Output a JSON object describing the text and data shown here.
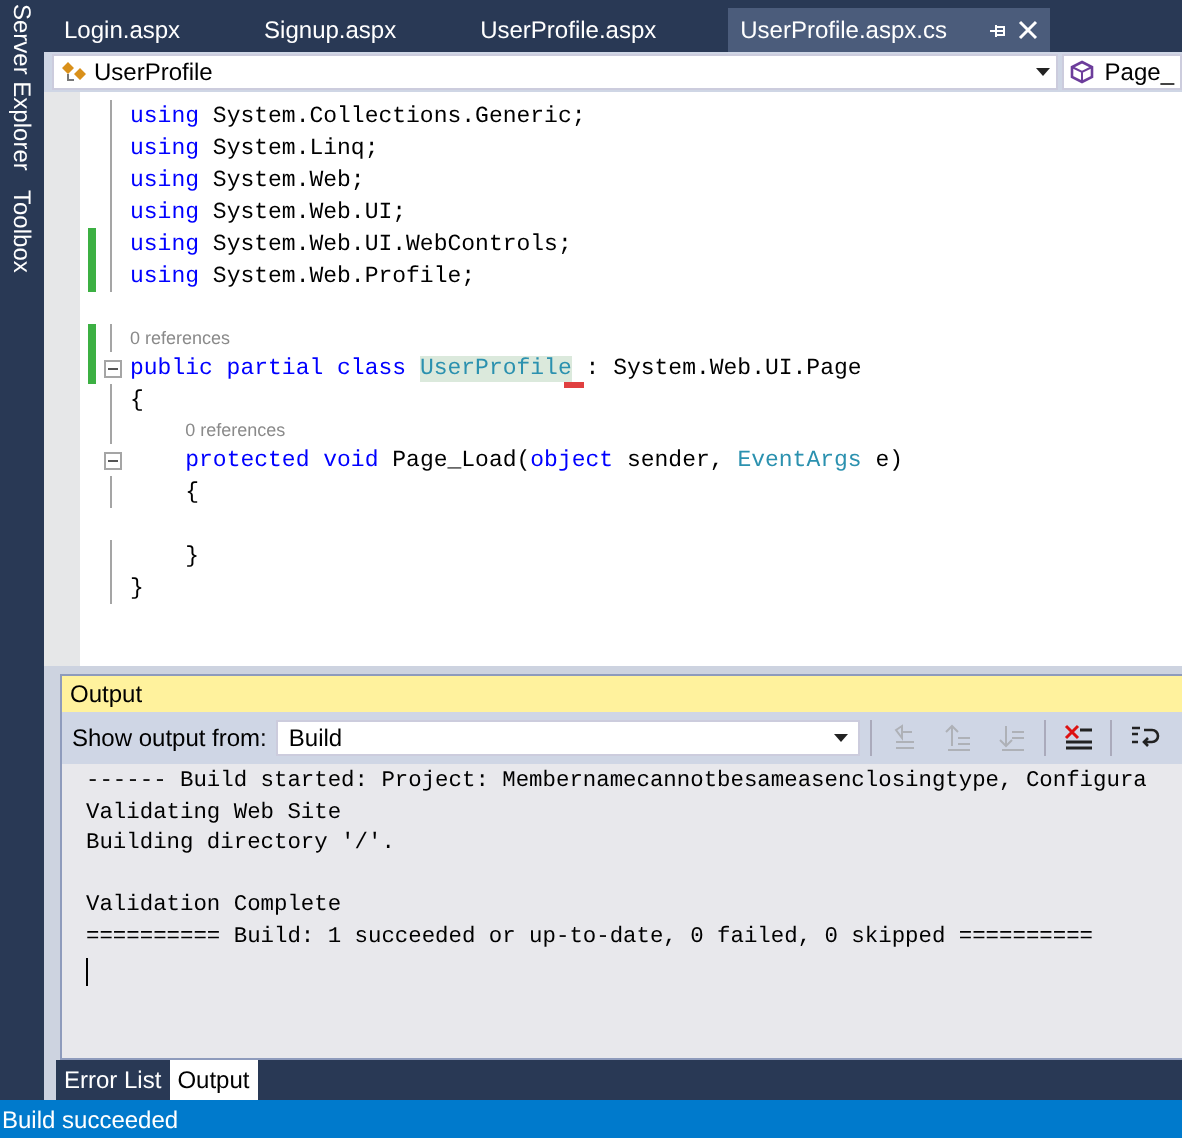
{
  "sidebar": {
    "tabs": [
      {
        "label": "Server Explorer"
      },
      {
        "label": "Toolbox"
      }
    ]
  },
  "document_tabs": [
    {
      "label": "Login.aspx",
      "selected": false
    },
    {
      "label": "Signup.aspx",
      "selected": false
    },
    {
      "label": "UserProfile.aspx",
      "selected": false
    },
    {
      "label": "UserProfile.aspx.cs",
      "selected": true
    }
  ],
  "navigation_bar": {
    "class_dropdown": "UserProfile",
    "member_dropdown": "Page_"
  },
  "code_lines": [
    {
      "kind": "code",
      "changed": false,
      "foldable": false,
      "segments": [
        {
          "text": "using",
          "kind": "keyword"
        },
        {
          "text": " System.Collections.Generic;",
          "kind": "plain"
        }
      ]
    },
    {
      "kind": "code",
      "changed": false,
      "foldable": false,
      "segments": [
        {
          "text": "using",
          "kind": "keyword"
        },
        {
          "text": " System.Linq;",
          "kind": "plain"
        }
      ]
    },
    {
      "kind": "code",
      "changed": false,
      "foldable": false,
      "segments": [
        {
          "text": "using",
          "kind": "keyword"
        },
        {
          "text": " System.Web;",
          "kind": "plain"
        }
      ]
    },
    {
      "kind": "code",
      "changed": false,
      "foldable": false,
      "segments": [
        {
          "text": "using",
          "kind": "keyword"
        },
        {
          "text": " System.Web.UI;",
          "kind": "plain"
        }
      ]
    },
    {
      "kind": "code",
      "changed": true,
      "foldable": false,
      "segments": [
        {
          "text": "using",
          "kind": "keyword"
        },
        {
          "text": " System.Web.UI.WebControls;",
          "kind": "plain"
        }
      ]
    },
    {
      "kind": "code",
      "changed": true,
      "foldable": false,
      "segments": [
        {
          "text": "using",
          "kind": "keyword"
        },
        {
          "text": " System.Web.Profile;",
          "kind": "plain"
        }
      ]
    },
    {
      "kind": "blank"
    },
    {
      "kind": "code",
      "changed": true,
      "foldable": true,
      "lens": "0 references",
      "segments": [
        {
          "text": "public partial class",
          "kind": "keyword"
        },
        {
          "text": "UserProfile",
          "kind": "highlight"
        },
        {
          "text": " : System.Web.UI.Page",
          "kind": "plain"
        }
      ]
    },
    {
      "kind": "code",
      "changed": false,
      "foldable": false,
      "segments": [
        {
          "text": "{",
          "kind": "plain"
        }
      ]
    },
    {
      "kind": "code",
      "changed": false,
      "foldable": true,
      "lens": "0 references",
      "segments": [
        {
          "text": "    protected void",
          "kind": "keyword"
        },
        {
          "text": " Page_Load(",
          "kind": "plain"
        },
        {
          "text": "object",
          "kind": "keyword"
        },
        {
          "text": " sender, ",
          "kind": "plain"
        },
        {
          "text": "EventArgs",
          "kind": "type"
        },
        {
          "text": " e)",
          "kind": "plain"
        }
      ]
    },
    {
      "kind": "code",
      "changed": false,
      "foldable": false,
      "segments": [
        {
          "text": "    {",
          "kind": "plain"
        }
      ]
    },
    {
      "kind": "blank"
    },
    {
      "kind": "code",
      "changed": false,
      "foldable": false,
      "segments": [
        {
          "text": "    }",
          "kind": "plain"
        }
      ]
    },
    {
      "kind": "code",
      "changed": false,
      "foldable": false,
      "segments": [
        {
          "text": "}",
          "kind": "plain"
        }
      ]
    }
  ],
  "output": {
    "title": "Output",
    "source_label": "Show output from:",
    "source": "Build",
    "toolbar": [
      {
        "kind": "goto-location",
        "disabled": true
      },
      {
        "kind": "previous-message",
        "disabled": true
      },
      {
        "kind": "next-message",
        "disabled": true
      },
      {
        "kind": "clear-all",
        "disabled": false
      },
      {
        "kind": "word-wrap",
        "disabled": false
      }
    ],
    "lines": [
      {
        "kind": "text",
        "text": "------ Build started: Project: Membernamecannotbesameasenclosingtype, Configura"
      },
      {
        "kind": "text",
        "text": "Validating Web Site"
      },
      {
        "kind": "text",
        "text": "Building directory '/'."
      },
      {
        "kind": "blank"
      },
      {
        "kind": "text",
        "text": "Validation Complete"
      },
      {
        "kind": "text",
        "text": "========== Build: 1 succeeded or up-to-date, 0 failed, 0 skipped =========="
      }
    ]
  },
  "panel_tabs": [
    {
      "label": "Error List",
      "selected": false
    },
    {
      "label": "Output",
      "selected": true
    }
  ],
  "status_bar": {
    "text": "Build succeeded"
  }
}
